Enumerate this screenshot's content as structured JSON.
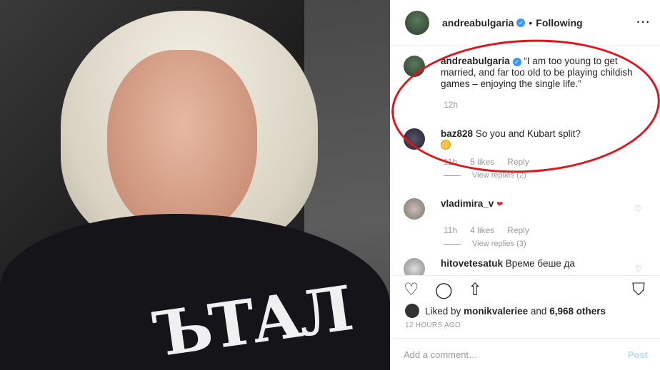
{
  "post": {
    "author": "andreabulgaria",
    "follow_dot": "•",
    "follow_status": "Following",
    "more_icon": "⋯"
  },
  "photo": {
    "shirt_logo": "ЪТАЛ"
  },
  "comments": [
    {
      "user": "andreabulgaria",
      "text": "“I am too young to get married, and far too old to be playing childish games – enjoying the single life.”",
      "time": "12h"
    },
    {
      "user": "baz828",
      "text": "So you and Kubart split?",
      "emoji": "flushed-face",
      "time": "11h",
      "likes": "5 likes",
      "reply": "Reply",
      "view_replies": "View replies (2)"
    },
    {
      "user": "vladimira_v",
      "text": "",
      "badge": "heart",
      "time": "11h",
      "likes": "4 likes",
      "reply": "Reply",
      "view_replies": "View replies (3)"
    },
    {
      "user": "hitovetesatuk",
      "text": "Време беше да"
    }
  ],
  "actions": {
    "like_icon": "♡",
    "comment_icon": "◯",
    "share_icon": "⇧",
    "save_icon": "⛉"
  },
  "likes": {
    "prefix": "Liked by",
    "user": "monikvaleriee",
    "middle": "and",
    "others": "6,968 others"
  },
  "timestamp": "12 HOURS AGO",
  "add_comment": {
    "placeholder": "Add a comment…",
    "post_label": "Post"
  },
  "colors": {
    "verified": "#3897f0",
    "annotation_ring": "#e0141b",
    "post_disabled": "#b3dbff"
  }
}
